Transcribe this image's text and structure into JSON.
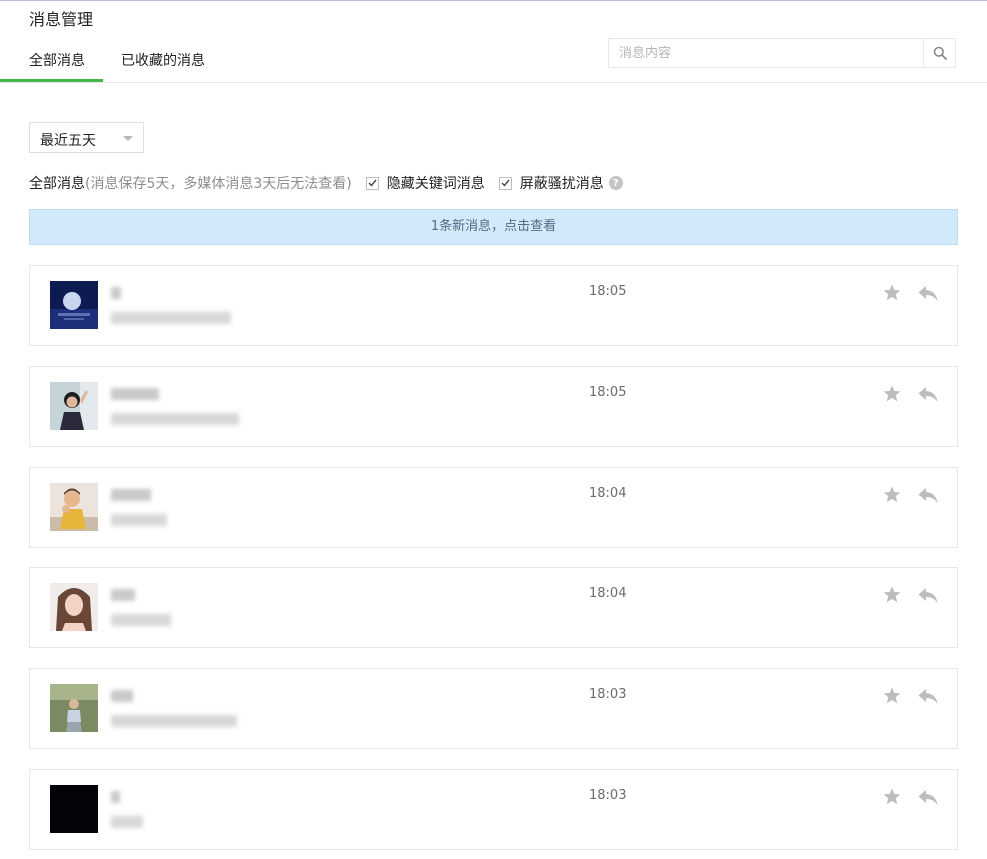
{
  "page": {
    "title": "消息管理"
  },
  "tabs": [
    {
      "label": "全部消息",
      "active": true
    },
    {
      "label": "已收藏的消息",
      "active": false
    }
  ],
  "search": {
    "placeholder": "消息内容",
    "icon": "search-icon"
  },
  "filter": {
    "range": "最近五天"
  },
  "options": {
    "main_label": "全部消息",
    "note": "(消息保存5天，多媒体消息3天后无法查看)",
    "hide_keyword": {
      "label": "隐藏关键词消息",
      "checked": true
    },
    "block_spam": {
      "label": "屏蔽骚扰消息",
      "checked": true
    },
    "help_icon": "question-icon"
  },
  "banner": {
    "text": "1条新消息，点击查看"
  },
  "messages": [
    {
      "time": "18:05"
    },
    {
      "time": "18:05"
    },
    {
      "time": "18:04"
    },
    {
      "time": "18:04"
    },
    {
      "time": "18:03"
    },
    {
      "time": "18:03"
    }
  ],
  "colors": {
    "accent": "#44b549",
    "banner_bg": "#d2e9fa",
    "icon_gray": "#bdbdbd"
  }
}
